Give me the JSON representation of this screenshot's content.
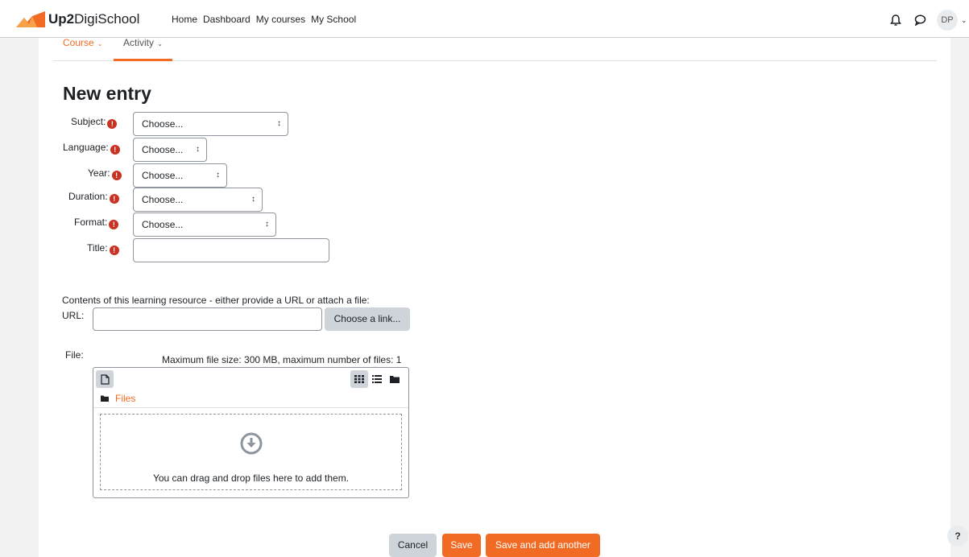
{
  "brand": {
    "name_bold": "Up2",
    "name_rest": "DigiSchool",
    "logo_colors": [
      "#f26b25",
      "#f7a14a"
    ]
  },
  "nav": {
    "links": [
      "Home",
      "Dashboard",
      "My courses",
      "My School"
    ],
    "user_initials": "DP"
  },
  "secondary_nav": {
    "course": "Course",
    "activity": "Activity"
  },
  "page_title": "New entry",
  "form": {
    "subject": {
      "label": "Subject:",
      "value": "Choose..."
    },
    "language": {
      "label": "Language:",
      "value": "Choose..."
    },
    "year": {
      "label": "Year:",
      "value": "Choose..."
    },
    "duration": {
      "label": "Duration:",
      "value": "Choose..."
    },
    "format": {
      "label": "Format:",
      "value": "Choose..."
    },
    "title": {
      "label": "Title:",
      "value": ""
    },
    "required_glyph": "!",
    "intro": "Contents of this learning resource - either provide a URL or attach a file:",
    "url": {
      "label": "URL:",
      "value": "",
      "choose_link": "Choose a link..."
    },
    "file": {
      "label": "File:",
      "limits": "Maximum file size: 300 MB, maximum number of files: 1"
    }
  },
  "filemanager": {
    "path": "Files",
    "drop_text": "You can drag and drop files here to add them."
  },
  "actions": {
    "cancel": "Cancel",
    "save": "Save",
    "save_and_add": "Save and add another"
  },
  "help": "?",
  "colors": {
    "accent": "#f26b25",
    "required": "#ca3120",
    "button_grey": "#ced4da"
  }
}
